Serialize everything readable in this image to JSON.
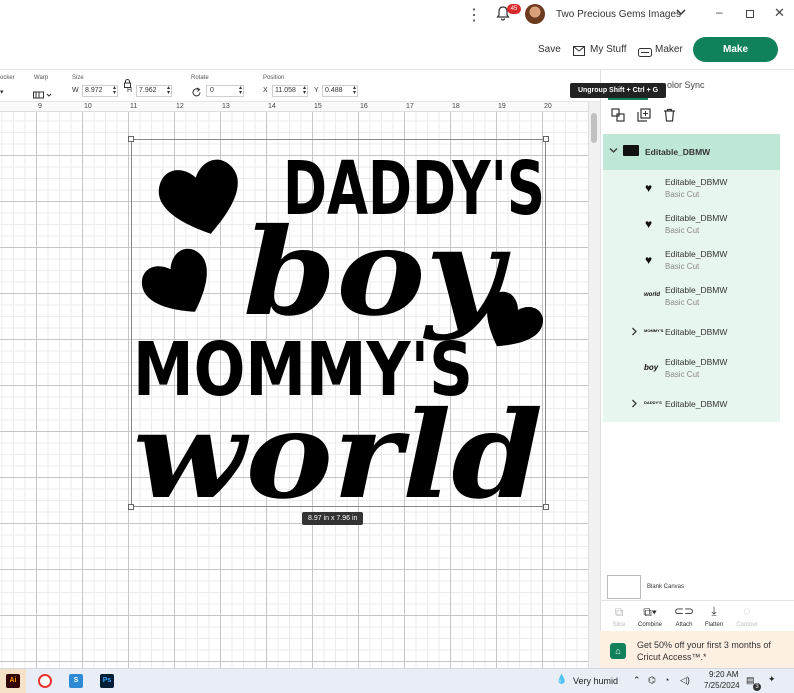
{
  "window": {
    "account_name": "Two Precious Gems Images",
    "notification_count": "45",
    "icons": [
      "more-icon",
      "bell-icon",
      "chevron-down-icon",
      "minimize-icon",
      "maximize-icon",
      "close-icon"
    ]
  },
  "header": {
    "save_label": "Save",
    "mystuff_label": "My Stuff",
    "maker_label": "Maker",
    "make_label": "Make",
    "accent_color": "#10815a"
  },
  "toolbar": {
    "locker_label": "ocker",
    "warp_label": "Warp",
    "size_label": "Size",
    "w_label": "W",
    "w_value": "8.972",
    "h_label": "H",
    "h_value": "7.962",
    "rotate_label": "Rotate",
    "rotate_value": "0",
    "position_label": "Position",
    "x_label": "X",
    "x_value": "11.058",
    "y_label": "Y",
    "y_value": "0.488"
  },
  "ruler": [
    "9",
    "10",
    "11",
    "12",
    "13",
    "14",
    "15",
    "16",
    "17",
    "18",
    "19",
    "20"
  ],
  "canvas": {
    "dimensions": "8.97  in x 7.96  in",
    "design": {
      "line1": "DADDY'S",
      "line2": "boy",
      "line3": "MOMMY'S",
      "line4": "world"
    }
  },
  "panel": {
    "tooltip": "Ungroup Shift + Ctrl + G",
    "tab_colorsync": "olor Sync",
    "group_name": "Editable_DBMW",
    "layers": [
      {
        "name": "Editable_DBMW",
        "sub": "Basic Cut",
        "thumb": "heart"
      },
      {
        "name": "Editable_DBMW",
        "sub": "Basic Cut",
        "thumb": "heart"
      },
      {
        "name": "Editable_DBMW",
        "sub": "Basic Cut",
        "thumb": "heart"
      },
      {
        "name": "Editable_DBMW",
        "sub": "Basic Cut",
        "thumb": "world"
      },
      {
        "name": "Editable_DBMW",
        "sub": "",
        "thumb": "MOMMY'S"
      },
      {
        "name": "Editable_DBMW",
        "sub": "Basic Cut",
        "thumb": "boy"
      },
      {
        "name": "Editable_DBMW",
        "sub": "",
        "thumb": "DADDY'S"
      }
    ],
    "blank_canvas": "Blank Canvas",
    "tools": [
      "Slice",
      "Combine",
      "Attach",
      "Flatten",
      "Contour"
    ],
    "promo": "Get 50% off your first 3 months of Cricut Access™.*"
  },
  "taskbar": {
    "weather": "Very humid",
    "time": "9:20 AM",
    "date": "7/25/2024",
    "badge": "3"
  }
}
